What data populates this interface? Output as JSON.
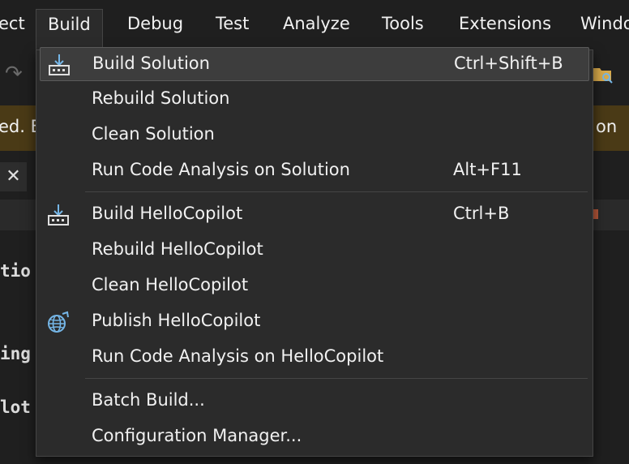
{
  "menubar": {
    "items": [
      "ect",
      "Build",
      "Debug",
      "Test",
      "Analyze",
      "Tools",
      "Extensions",
      "Windo"
    ]
  },
  "infobar": {
    "left_text": "ed. B",
    "right_text": "on"
  },
  "editor": {
    "lines": [
      "tio",
      "ing",
      "lot"
    ]
  },
  "icons": {
    "build": "build-icon",
    "publish": "publish-globe-icon",
    "undo": "undo-icon",
    "folder": "folder-search-icon",
    "close": "close-icon"
  },
  "colors": {
    "icon_blue": "#75b6e7",
    "menu_bg": "#2b2b2b",
    "highlight": "#3d3d3d",
    "infobar": "#4a3a16"
  },
  "dropdown": {
    "items": [
      {
        "label": "Build Solution",
        "shortcut": "Ctrl+Shift+B"
      },
      {
        "label": "Rebuild Solution",
        "shortcut": ""
      },
      {
        "label": "Clean Solution",
        "shortcut": ""
      },
      {
        "label": "Run Code Analysis on Solution",
        "shortcut": "Alt+F11"
      },
      {
        "label": "Build HelloCopilot",
        "shortcut": "Ctrl+B"
      },
      {
        "label": "Rebuild HelloCopilot",
        "shortcut": ""
      },
      {
        "label": "Clean HelloCopilot",
        "shortcut": ""
      },
      {
        "label": "Publish HelloCopilot",
        "shortcut": ""
      },
      {
        "label": "Run Code Analysis on HelloCopilot",
        "shortcut": ""
      },
      {
        "label": "Batch Build...",
        "shortcut": ""
      },
      {
        "label": "Configuration Manager...",
        "shortcut": ""
      }
    ]
  }
}
